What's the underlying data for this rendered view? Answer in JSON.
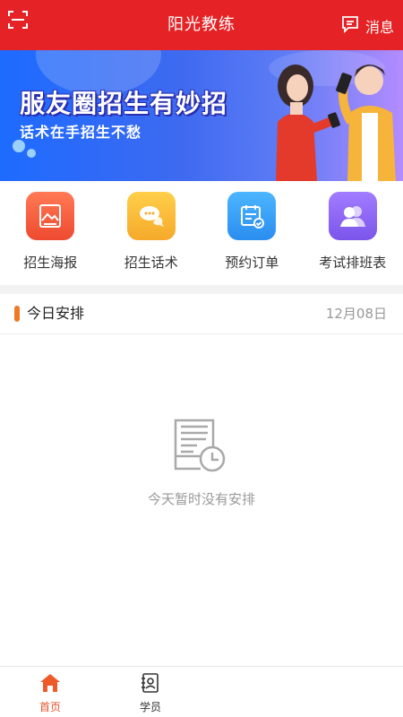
{
  "header": {
    "title": "阳光教练",
    "message_label": "消息"
  },
  "banner": {
    "headline": "服友圈招生有妙招",
    "subtitle": "话术在手招生不愁"
  },
  "quick_actions": [
    {
      "label": "招生海报",
      "icon": "poster-icon",
      "color": "#f15a3c"
    },
    {
      "label": "招生话术",
      "icon": "chat-bubbles-icon",
      "color": "#f8b42c"
    },
    {
      "label": "预约订单",
      "icon": "calendar-check-icon",
      "color": "#2f9af0"
    },
    {
      "label": "考试排班表",
      "icon": "people-icon",
      "color": "#8a63ee"
    }
  ],
  "schedule": {
    "title": "今日安排",
    "date": "12月08日",
    "empty_text": "今天暂时没有安排"
  },
  "tabbar": [
    {
      "label": "首页",
      "icon": "home-icon",
      "active": true,
      "color": "#e5542c"
    },
    {
      "label": "学员",
      "icon": "student-card-icon",
      "active": false,
      "color": "#333333"
    }
  ],
  "colors": {
    "header_bg": "#e52225",
    "accent": "#f07a23"
  }
}
